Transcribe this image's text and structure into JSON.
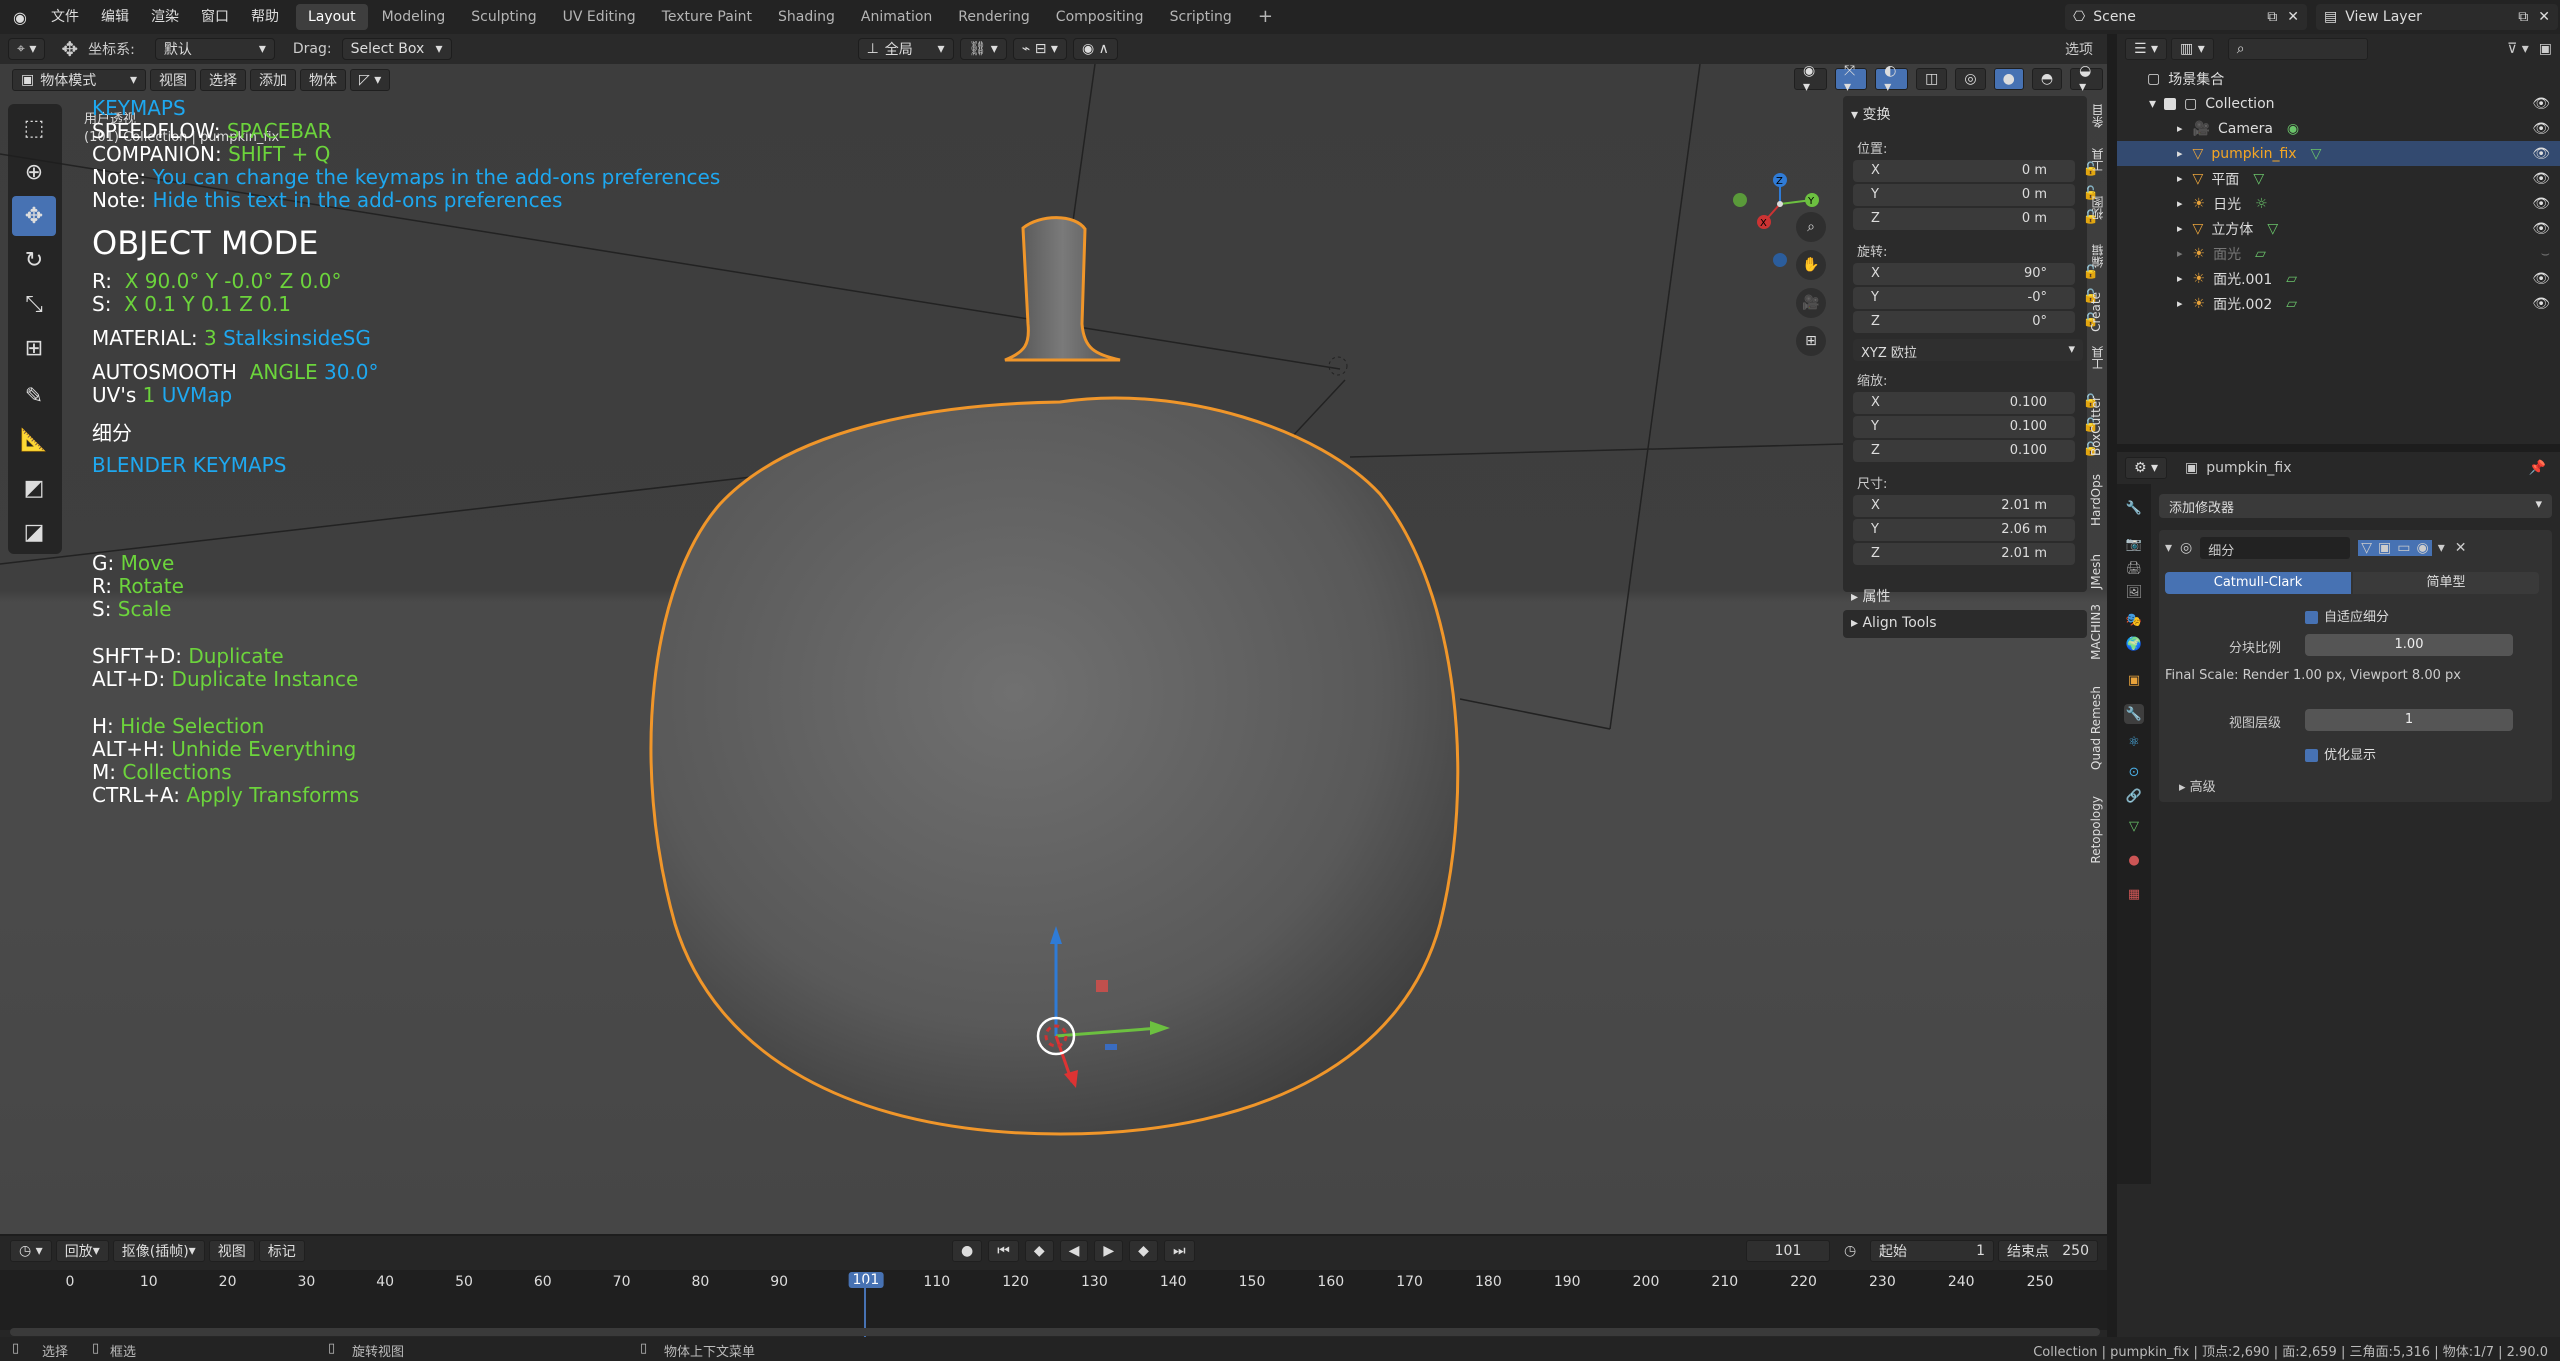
{
  "menu": [
    "文件",
    "编辑",
    "渲染",
    "窗口",
    "帮助"
  ],
  "workspaces": [
    "Layout",
    "Modeling",
    "Sculpting",
    "UV Editing",
    "Texture Paint",
    "Shading",
    "Animation",
    "Rendering",
    "Compositing",
    "Scripting"
  ],
  "scene": "Scene",
  "view_layer": "View Layer",
  "header": {
    "coord_label": "坐标系:",
    "coord_value": "默认",
    "drag_label": "Drag:",
    "drag_value": "Select Box",
    "pivot_value": "全局",
    "options": "选项"
  },
  "ctx_menu": {
    "mode": "物体模式",
    "view": "视图",
    "select": "选择",
    "add": "添加",
    "object": "物体"
  },
  "viewport_text": {
    "view_name": "用户透视",
    "collection": "(101) Collection | pumpkin_fix",
    "keymaps": "KEYMAPS",
    "speedflow_label": "SPEEDFLOW:",
    "speedflow_key": "SPACEBAR",
    "companion_label": "COMPANION:",
    "companion_key": "SHIFT + Q",
    "note1_label": "Note:",
    "note1_text": "You can change the keymaps in the add-ons preferences",
    "note2_label": "Note:",
    "note2_text": "Hide this text in the add-ons preferences",
    "mode": "OBJECT MODE",
    "r_label": "R:",
    "r_vals": "X 90.0° Y -0.0° Z 0.0°",
    "s_label": "S:",
    "s_vals": "X 0.1 Y 0.1 Z 0.1",
    "material_label": "MATERIAL:",
    "material_count": "3",
    "material_name": "StalksinsideSG",
    "autosmooth_label": "AUTOSMOOTH",
    "angle_label": "ANGLE",
    "angle_val": "30.0°",
    "uvs_label": "UV's",
    "uvs_count": "1",
    "uvs_name": "UVMap",
    "subdiv": "细分",
    "blender_keymaps": "BLENDER KEYMAPS",
    "keys": [
      {
        "k": "G:",
        "v": "Move"
      },
      {
        "k": "R:",
        "v": "Rotate"
      },
      {
        "k": "S:",
        "v": "Scale"
      },
      {
        "k": "SHFT+D:",
        "v": "Duplicate"
      },
      {
        "k": "ALT+D:",
        "v": "Duplicate Instance"
      },
      {
        "k": "H:",
        "v": "Hide Selection"
      },
      {
        "k": "ALT+H:",
        "v": "Unhide Everything"
      },
      {
        "k": "M:",
        "v": "Collections"
      },
      {
        "k": "CTRL+A:",
        "v": "Apply Transforms"
      }
    ]
  },
  "npanel": {
    "transform": "变换",
    "location": "位置:",
    "loc": [
      "0 m",
      "0 m",
      "0 m"
    ],
    "rotation": "旋转:",
    "rot": [
      "90°",
      "-0°",
      "0°"
    ],
    "rot_mode": "XYZ 欧拉",
    "scale": "缩放:",
    "scl": [
      "0.100",
      "0.100",
      "0.100"
    ],
    "dimensions": "尺寸:",
    "dim": [
      "2.01 m",
      "2.06 m",
      "2.01 m"
    ],
    "axes": [
      "X",
      "Y",
      "Z"
    ],
    "properties": "属性",
    "align_tools": "Align Tools"
  },
  "side_tabs": [
    "条目",
    "工具",
    "视图",
    "编辑",
    "Create",
    "工具",
    "BoxCutter",
    "HardOps",
    "JMesh",
    "MACHIN3",
    "Quad Remesh",
    "Retopology"
  ],
  "outliner": {
    "root": "场景集合",
    "collection": "Collection",
    "items": [
      "Camera",
      "pumpkin_fix",
      "平面",
      "日光",
      "立方体",
      "面光",
      "面光.001",
      "面光.002"
    ]
  },
  "properties": {
    "object_name": "pumpkin_fix",
    "add_modifier": "添加修改器",
    "modifier_name": "细分",
    "catmull": "Catmull-Clark",
    "simple": "简单型",
    "adaptive": "自适应细分",
    "dicing_label": "分块比例",
    "dicing_value": "1.00",
    "final_scale": "Final Scale: Render 1.00 px, Viewport 8.00 px",
    "levels_label": "视图层级",
    "levels_value": "1",
    "optimal": "优化显示",
    "advanced": "高级"
  },
  "timeline": {
    "playback": "回放",
    "keying": "抠像(插帧)",
    "view": "视图",
    "marker": "标记",
    "current": "101",
    "start_label": "起始",
    "start": "1",
    "end_label": "结束点",
    "end": "250",
    "ticks": [
      "0",
      "10",
      "20",
      "30",
      "40",
      "50",
      "60",
      "70",
      "80",
      "90",
      "101",
      "110",
      "120",
      "130",
      "140",
      "150",
      "160",
      "170",
      "180",
      "190",
      "200",
      "210",
      "220",
      "230",
      "240",
      "250"
    ]
  },
  "status": {
    "select": "选择",
    "box_select": "框选",
    "rotate_view": "旋转视图",
    "context_menu": "物体上下文菜单",
    "info": "Collection | pumpkin_fix | 顶点:2,690 | 面:2,659 | 三角面:5,316 | 物体:1/7 | 2.90.0"
  },
  "colors": {
    "green": "#6cd43c",
    "blue": "#1ea8f0",
    "accent": "#4772b3",
    "selection": "#f5a623"
  }
}
